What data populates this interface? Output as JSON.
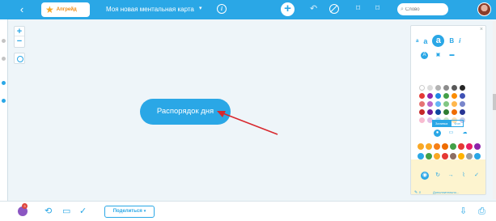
{
  "topbar": {
    "back_icon": "chevron-left-icon",
    "upgrade_label": "Апгрейд",
    "upgrade_icon": "star-icon",
    "map_title": "Моя новая ментальная карта",
    "title_caret": "▾",
    "info_icon": "info-icon",
    "add_icon": "plus-icon",
    "undo_icon": "undo-icon",
    "nodraw_icon": "no-draw-icon",
    "search_placeholder": "Слово",
    "colors": {
      "bar": "#2aa7e6",
      "accent": "#f7a823"
    }
  },
  "canvas": {
    "zoom_in": "+",
    "zoom_out": "−",
    "node_text": "Распорядок дня",
    "annotation_color": "#d8282e"
  },
  "style_panel": {
    "close": "×",
    "font_sizes": [
      "a",
      "a",
      "a",
      "B",
      "i"
    ],
    "segment_labels": [
      "Заливка",
      "Фон"
    ],
    "notes_link": "Дополнительно...",
    "swatch_colors": [
      "#ffffff",
      "#dcdcdc",
      "#b3b3b3",
      "#8c8c8c",
      "#595959",
      "#262626",
      "#e53935",
      "#8e24aa",
      "#1e88e5",
      "#43a047",
      "#fb8c00",
      "#3f51b5",
      "#e57373",
      "#ba68c8",
      "#64b5f6",
      "#81c784",
      "#ffb74d",
      "#7986cb",
      "#c62828",
      "#6a1b9a",
      "#0d47a1",
      "#2e7d32",
      "#ef6c00",
      "#283593",
      "#f8bbd0",
      "#e1bee7",
      "#bbdefb",
      "#c8e6c9",
      "#ffe0b2",
      "#c5cae9"
    ],
    "emoji_colors": [
      "#f9a825",
      "#f9a825",
      "#f57f17",
      "#ef6c00",
      "#43a047",
      "#e53935",
      "#e91e63",
      "#8e24aa",
      "#2aa7e6",
      "#43a047",
      "#f9a825",
      "#e53935",
      "#8d6e63",
      "#ffb300",
      "#9e9e9e",
      "#2aa7e6"
    ]
  },
  "bottombar": {
    "share_label": "Поделиться",
    "share_caret": "▾",
    "badge_count": "3"
  }
}
